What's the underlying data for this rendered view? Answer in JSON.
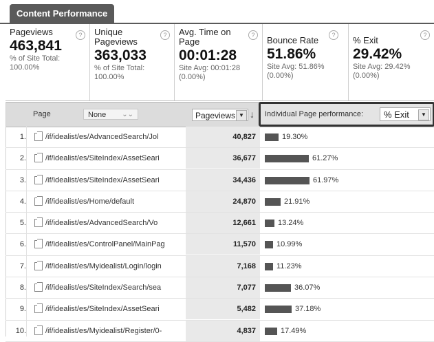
{
  "tab": {
    "label": "Content Performance"
  },
  "metrics": [
    {
      "label": "Pageviews",
      "value": "463,841",
      "sub1": "% of Site Total:",
      "sub2": "100.00%"
    },
    {
      "label": "Unique Pageviews",
      "value": "363,033",
      "sub1": "% of Site Total:",
      "sub2": "100.00%"
    },
    {
      "label": "Avg. Time on Page",
      "value": "00:01:28",
      "sub1": "Site Avg: 00:01:28",
      "sub2": "(0.00%)"
    },
    {
      "label": "Bounce Rate",
      "value": "51.86%",
      "sub1": "Site Avg: 51.86%",
      "sub2": "(0.00%)"
    },
    {
      "label": "% Exit",
      "value": "29.42%",
      "sub1": "Site Avg: 29.42%",
      "sub2": "(0.00%)"
    }
  ],
  "header": {
    "page_label": "Page",
    "secondary_dim": "None",
    "primary_metric": "Pageviews",
    "perf_label": "Individual Page performance:",
    "perf_metric": "% Exit"
  },
  "rows": [
    {
      "num": "1.",
      "url": "/if/idealist/es/AdvancedSearch/Jol",
      "pv": "40,827",
      "pct": "19.30%",
      "exit": 19.3
    },
    {
      "num": "2.",
      "url": "/if/idealist/es/SiteIndex/AssetSeari",
      "pv": "36,677",
      "pct": "61.27%",
      "exit": 61.27
    },
    {
      "num": "3.",
      "url": "/if/idealist/es/SiteIndex/AssetSeari",
      "pv": "34,436",
      "pct": "61.97%",
      "exit": 61.97
    },
    {
      "num": "4.",
      "url": "/if/idealist/es/Home/default",
      "pv": "24,870",
      "pct": "21.91%",
      "exit": 21.91
    },
    {
      "num": "5.",
      "url": "/if/idealist/es/AdvancedSearch/Vo",
      "pv": "12,661",
      "pct": "13.24%",
      "exit": 13.24
    },
    {
      "num": "6.",
      "url": "/if/idealist/es/ControlPanel/MainPag",
      "pv": "11,570",
      "pct": "10.99%",
      "exit": 10.99
    },
    {
      "num": "7.",
      "url": "/if/idealist/es/Myidealist/Login/login",
      "pv": "7,168",
      "pct": "11.23%",
      "exit": 11.23
    },
    {
      "num": "8.",
      "url": "/if/idealist/es/SiteIndex/Search/sea",
      "pv": "7,077",
      "pct": "36.07%",
      "exit": 36.07
    },
    {
      "num": "9.",
      "url": "/if/idealist/es/SiteIndex/AssetSeari",
      "pv": "5,482",
      "pct": "37.18%",
      "exit": 37.18
    },
    {
      "num": "10.",
      "url": "/if/idealist/es/Myidealist/Register/0-",
      "pv": "4,837",
      "pct": "17.49%",
      "exit": 17.49
    }
  ]
}
